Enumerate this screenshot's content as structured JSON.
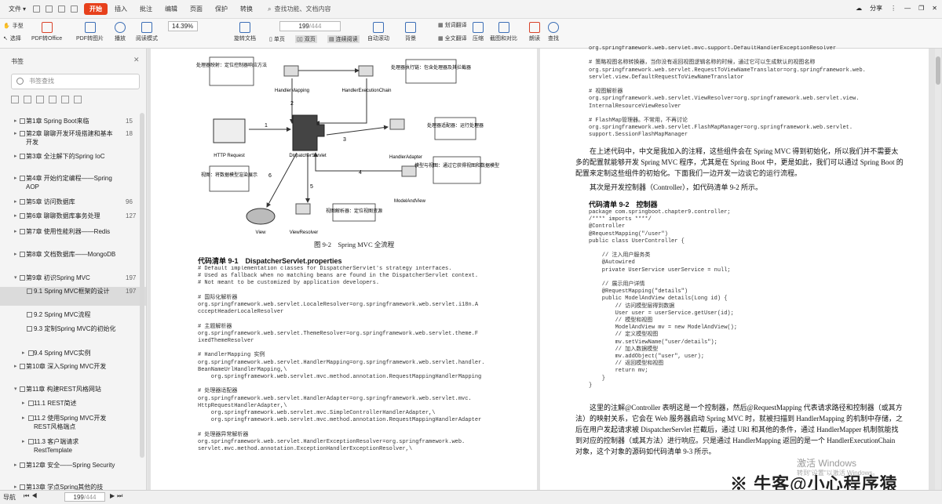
{
  "menu": {
    "file": "文件",
    "items": [
      "开始",
      "插入",
      "批注",
      "编辑",
      "页面",
      "保护",
      "转换"
    ],
    "search": "查找功能、文档内容",
    "share": "分享"
  },
  "toolbar": {
    "hand": "手型",
    "select": "选择",
    "pdf_to_office": "PDF转Office",
    "pdf_to_image": "PDF转图片",
    "play": "播放",
    "read_mode": "阅读模式",
    "zoom": "14.39%",
    "page_current": "199",
    "page_total": "/444",
    "rotate": "旋转文档",
    "single": "单页",
    "double": "双页",
    "continuous": "连续阅读",
    "auto_scroll": "自动滚动",
    "background": "背景",
    "translate": "划词翻译",
    "full_translate": "全文翻译",
    "compress": "压缩",
    "screenshot": "截图和对比",
    "read_aloud": "朗读",
    "find": "查找"
  },
  "sidebar": {
    "title": "书签",
    "search_placeholder": "书签查找",
    "items": [
      {
        "label": "第1章 Spring Boot来临",
        "page": "15",
        "sub": false,
        "expanded": false
      },
      {
        "label": "第2章 聊聊开发环境搭建和基本开发",
        "page": "18",
        "sub": false,
        "expanded": false
      },
      {
        "label": "第3章 全注解下的Spring IoC",
        "page": "",
        "sub": false,
        "expanded": false
      },
      {
        "label": "第4章 开始约定编程——Spring AOP",
        "page": "",
        "sub": false,
        "expanded": false
      },
      {
        "label": "第5章 访问数据库",
        "page": "96",
        "sub": false,
        "expanded": false
      },
      {
        "label": "第6章 聊聊数据库事务处理",
        "page": "127",
        "sub": false,
        "expanded": false
      },
      {
        "label": "第7章 使用性能利器——Redis",
        "page": "",
        "sub": false,
        "expanded": false
      },
      {
        "label": "第8章 文档数据库——MongoDB",
        "page": "",
        "sub": false,
        "expanded": false
      },
      {
        "label": "第9章 初识Spring MVC",
        "page": "197",
        "sub": false,
        "expanded": true
      },
      {
        "label": "9.1 Spring MVC框架的设计",
        "page": "197",
        "sub": true,
        "expanded": false
      },
      {
        "label": "9.2 Spring MVC流程",
        "page": "",
        "sub": true,
        "expanded": false
      },
      {
        "label": "9.3 定制Spring MVC的初始化",
        "page": "",
        "sub": true,
        "expanded": false
      },
      {
        "label": "9.4 Spring MVC实例",
        "page": "",
        "sub": true,
        "expanded": false
      },
      {
        "label": "第10章 深入Spring MVC开发",
        "page": "",
        "sub": false,
        "expanded": false
      },
      {
        "label": "第11章 构建REST风格网站",
        "page": "",
        "sub": false,
        "expanded": true
      },
      {
        "label": "11.1 REST简述",
        "page": "",
        "sub": true,
        "expanded": false
      },
      {
        "label": "11.2 使用Spring MVC开发REST风格端点",
        "page": "",
        "sub": true,
        "expanded": false
      },
      {
        "label": "11.3 客户端请求RestTemplate",
        "page": "",
        "sub": true,
        "expanded": false
      },
      {
        "label": "第12章 安全——Spring Security",
        "page": "",
        "sub": false,
        "expanded": false
      },
      {
        "label": "第13章 学点Spring其他的技",
        "page": "",
        "sub": false,
        "expanded": false
      }
    ]
  },
  "left_page": {
    "diagram": {
      "box1": "处理器映射：定位控制器响应方法",
      "box2": "处理器执行链：包含处理器及其拦截器",
      "box3": "处理器适配器：运行处理器",
      "box4": "视图：将数据模型渲染展示",
      "box5": "视图解析器：定位视图资源",
      "box6": "模型与视图：通过它获得视图和数据模型",
      "handler_mapping": "HandlerMapping",
      "handler_chain": "HandlerExecutionChain",
      "http": "HTTP Request",
      "dispatcher": "DispatcherServlet",
      "adapter": "HandlerAdapter",
      "mav": "ModelAndView",
      "view": "View",
      "resolver": "ViewResolver",
      "n1": "1",
      "n2": "2",
      "n3": "3",
      "n4": "4",
      "n5": "5",
      "n6": "6"
    },
    "figure_caption": "图 9-2　Spring MVC 全流程",
    "listing_title": "代码清单 9-1　DispatcherServlet.properties",
    "code": "# Default implementation classes for DispatcherServlet's strategy interfaces.\n# Used as fallback when no matching beans are found in the DispatcherServlet context.\n# Not meant to be customized by application developers.\n\n# 国际化解析器\norg.springframework.web.servlet.LocaleResolver=org.springframework.web.servlet.i18n.A\nccceptHeaderLocaleResolver\n\n# 主题解析器\norg.springframework.web.servlet.ThemeResolver=org.springframework.web.servlet.theme.F\nixedThemeResolver\n\n# HandlerMapping 实例\norg.springframework.web.servlet.HandlerMapping=org.springframework.web.servlet.handler.\nBeanNameUrlHandlerMapping,\\\n    org.springframework.web.servlet.mvc.method.annotation.RequestMappingHandlerMapping\n\n# 处理器适配器\norg.springframework.web.servlet.HandlerAdapter=org.springframework.web.servlet.mvc.\nHttpRequestHandlerAdapter,\\\n    org.springframework.web.servlet.mvc.SimpleControllerHandlerAdapter,\\\n    org.springframework.web.servlet.mvc.method.annotation.RequestMappingHandlerAdapter\n\n# 处理器异常解析器\norg.springframework.web.servlet.HandlerExceptionResolver=org.springframework.web.\nservlet.mvc.method.annotation.ExceptionHandlerExceptionResolver,\\"
  },
  "right_page": {
    "code_top": "org.springframework.web.servlet.mvc.support.DefaultHandlerExceptionResolver\n\n# 策略视图名称转换器，当你没有返回视图逻辑名称的时候，通过它可以生成默认的视图名称\norg.springframework.web.servlet.RequestToViewNameTranslator=org.springframework.web.\nservlet.view.DefaultRequestToViewNameTranslator\n\n# 视图解析器\norg.springframework.web.servlet.ViewResolver=org.springframework.web.servlet.view.\nInternalResourceViewResolver\n\n# FlashMap管理器。不常用，不再讨论\norg.springframework.web.servlet.FlashMapManager=org.springframework.web.servlet.\nsupport.SessionFlashMapManager",
    "para1": "在上述代码中，中文是我加入的注释，这些组件会在 Spring MVC 得到初始化，所以我们并不需要太多的配置就能够开发 Spring MVC 程序，尤其是在 Spring Boot 中，更是如此，我们可以通过 Spring Boot 的配置来定制这些组件的初始化。下面我们一边开发一边谈它的运行流程。",
    "para2": "其次是开发控制器（Controller），如代码清单 9-2 所示。",
    "listing_title": "代码清单 9-2　控制器",
    "code_ctrl": "package com.springboot.chapter9.controller;\n/**** imports ****/\n@Controller\n@RequestMapping(\"/user\")\npublic class UserController {\n\n    // 注入用户服务类\n    @Autowired\n    private UserService userService = null;\n\n    // 展示用户详情\n    @RequestMapping(\"details\")\n    public ModelAndView details(Long id) {\n        // 访问模型层得到数据\n        User user = userService.getUser(id);\n        // 模型和视图\n        ModelAndView mv = new ModelAndView();\n        // 定义模型视图\n        mv.setViewName(\"user/details\");\n        // 加入数据模型\n        mv.addObject(\"user\", user);\n        // 返回模型和视图\n        return mv;\n    }\n}",
    "para3": "这里的注解@Controller 表明这是一个控制器，然后@RequestMapping 代表请求路径和控制器（或其方法）的映射关系，它会在 Web 服务器启动 Spring MVC 时，就被扫描到 HandlerMapping 的机制中存储，之后在用户发起请求被 DispatcherServlet 拦截后，通过 URI 和其他的条件，通过 HandlerMapper 机制就能找到对应的控制器（或其方法）进行响应。只是通过 HandlerMapping 返回的是一个 HandlerExecutionChain 对象，这个对象的源码如代码清单 9-3 所示。"
  },
  "status": {
    "nav": "导航",
    "page_current": "199",
    "page_total": "/444"
  },
  "windows": {
    "line1": "激活 Windows",
    "line2": "转到\"设置\"以激活 Windows。"
  },
  "watermark": "※ 牛客@小心程序猿"
}
